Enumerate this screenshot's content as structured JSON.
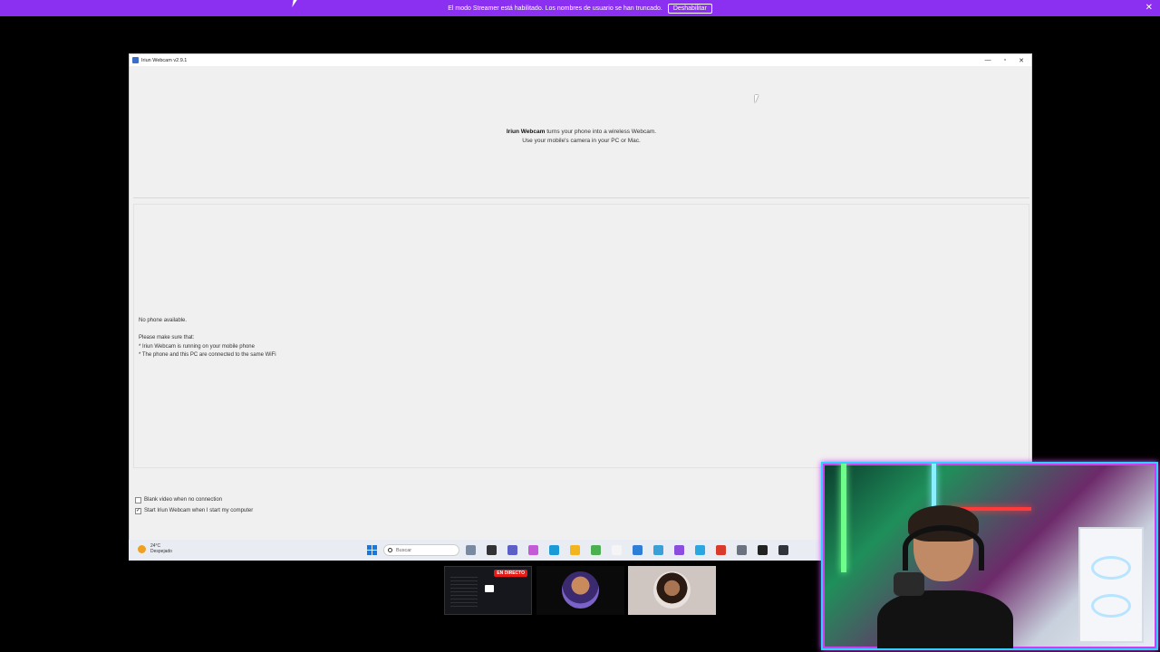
{
  "banner": {
    "message": "El modo Streamer está habilitado. Los nombres de usuario se han truncado.",
    "button_label": "Deshabilitar",
    "close_glyph": "✕",
    "color": "#8b2ff0"
  },
  "window": {
    "title": "Iriun Webcam v2.9.1",
    "minimize_glyph": "—",
    "maximize_glyph": "▫",
    "close_glyph": "✕"
  },
  "intro": {
    "app_name": "Iriun Webcam",
    "line1_rest": " turns your phone into a wireless Webcam.",
    "line2": "Use your mobile's camera in your PC or Mac."
  },
  "status": {
    "no_phone": "No phone available.",
    "make_sure": "Please make sure that:",
    "bullet1": "* Iriun Webcam is running on your mobile phone",
    "bullet2": "* The phone and this PC are connected to the same WiFi"
  },
  "options": {
    "blank_video": {
      "label": "Blank video when no connection",
      "checked": false
    },
    "start_with_computer": {
      "label": "Start Iriun Webcam when I start my computer",
      "checked": true
    }
  },
  "taskbar": {
    "temperature": "24°C",
    "weather": "Despejado",
    "search_placeholder": "Buscar",
    "app_icons": [
      {
        "name": "task-view-icon",
        "color": "#7a8aa0"
      },
      {
        "name": "file-icon",
        "color": "#333333"
      },
      {
        "name": "teams-icon",
        "color": "#5b5fc7"
      },
      {
        "name": "copilot-icon",
        "color": "#c45ad6"
      },
      {
        "name": "edge-icon",
        "color": "#1a9bd8"
      },
      {
        "name": "explorer-icon",
        "color": "#f2b51d"
      },
      {
        "name": "utorrent-icon",
        "color": "#4caf50"
      },
      {
        "name": "notepad-icon",
        "color": "#f5f5f5"
      },
      {
        "name": "app-icon-blue",
        "color": "#2e7dd8"
      },
      {
        "name": "notes-icon",
        "color": "#39a0d8"
      },
      {
        "name": "messenger-icon",
        "color": "#8a4de0"
      },
      {
        "name": "app-icon-cyan",
        "color": "#2aa7e0"
      },
      {
        "name": "chrome-icon",
        "color": "#d93a2b"
      },
      {
        "name": "settings-icon",
        "color": "#6b7380"
      },
      {
        "name": "obs-icon",
        "color": "#222222"
      },
      {
        "name": "webcam-app-icon",
        "color": "#30343c"
      }
    ]
  },
  "thumbnails": {
    "live_badge": "EN DIRECTO"
  }
}
